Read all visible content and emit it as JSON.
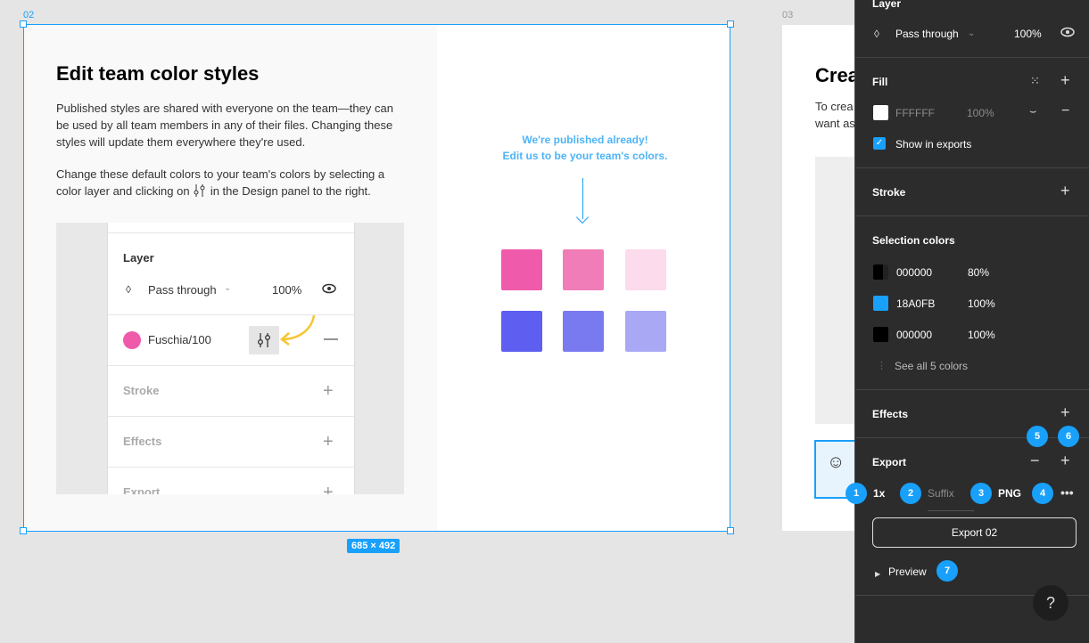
{
  "canvas": {
    "frame02_label": "02",
    "frame03_label": "03",
    "frame03_title": "Crea",
    "frame03_para_1": "To crea",
    "frame03_para_2": "want as",
    "size_badge": "685 × 492",
    "title": "Edit team color styles",
    "para1": "Published styles are shared with everyone on the team—they can be used by all team members in any of their files. Changing these styles will update them everywhere they're used.",
    "para2_pre": "Change these default colors to your team's colors by selecting a color layer and clicking on",
    "para2_post": "in the Design panel to the right.",
    "callout_line1": "We're published already!",
    "callout_line2": "Edit us to be your team's colors.",
    "swatch_colors": [
      "#f05aab",
      "#f07db7",
      "#fbdbec",
      "#5e5ef0",
      "#7a7af0",
      "#a8a8f5"
    ],
    "mock": {
      "layer_title": "Layer",
      "blend": "Pass through",
      "opacity": "100%",
      "fill_name": "Fuschia/100",
      "fill_color": "#f05aab",
      "stroke": "Stroke",
      "effects": "Effects",
      "export": "Export"
    }
  },
  "panel": {
    "layer": {
      "title": "Layer",
      "blend": "Pass through",
      "opacity": "100%"
    },
    "fill": {
      "title": "Fill",
      "hex": "FFFFFF",
      "opacity": "100%",
      "show_in_exports": "Show in exports"
    },
    "stroke": {
      "title": "Stroke"
    },
    "selection_colors": {
      "title": "Selection colors",
      "items": [
        {
          "hex": "000000",
          "opacity": "80%",
          "color": "#000000"
        },
        {
          "hex": "18A0FB",
          "opacity": "100%",
          "color": "#18a0fb"
        },
        {
          "hex": "000000",
          "opacity": "100%",
          "color": "#000000"
        }
      ],
      "see_all": "See all 5 colors"
    },
    "effects": {
      "title": "Effects"
    },
    "export": {
      "title": "Export",
      "scale": "1x",
      "suffix_placeholder": "Suffix",
      "format": "PNG",
      "button": "Export 02",
      "preview": "Preview"
    },
    "help": "?",
    "badges": [
      "1",
      "2",
      "3",
      "4",
      "5",
      "6",
      "7"
    ]
  },
  "colors": {
    "accent": "#18a0fb",
    "panel_bg": "#2c2c2c"
  }
}
